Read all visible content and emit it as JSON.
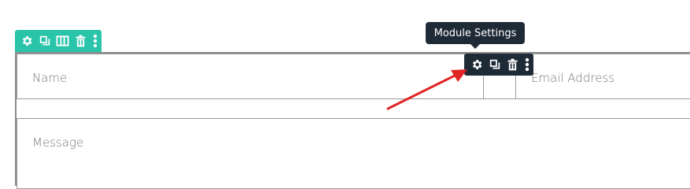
{
  "form": {
    "name_placeholder": "Name",
    "email_placeholder": "Email Address",
    "message_placeholder": "Message"
  },
  "row_toolbar": {
    "color": "#29c4a9",
    "icons": [
      "gear-icon",
      "duplicate-icon",
      "columns-icon",
      "trash-icon",
      "more-vertical-icon"
    ]
  },
  "module_toolbar": {
    "color": "#1f2a37",
    "icons": [
      "gear-icon",
      "duplicate-icon",
      "trash-icon",
      "more-vertical-icon"
    ]
  },
  "tooltip": {
    "text": "Module Settings"
  },
  "annotation": {
    "color": "#e02424",
    "type": "arrow"
  }
}
